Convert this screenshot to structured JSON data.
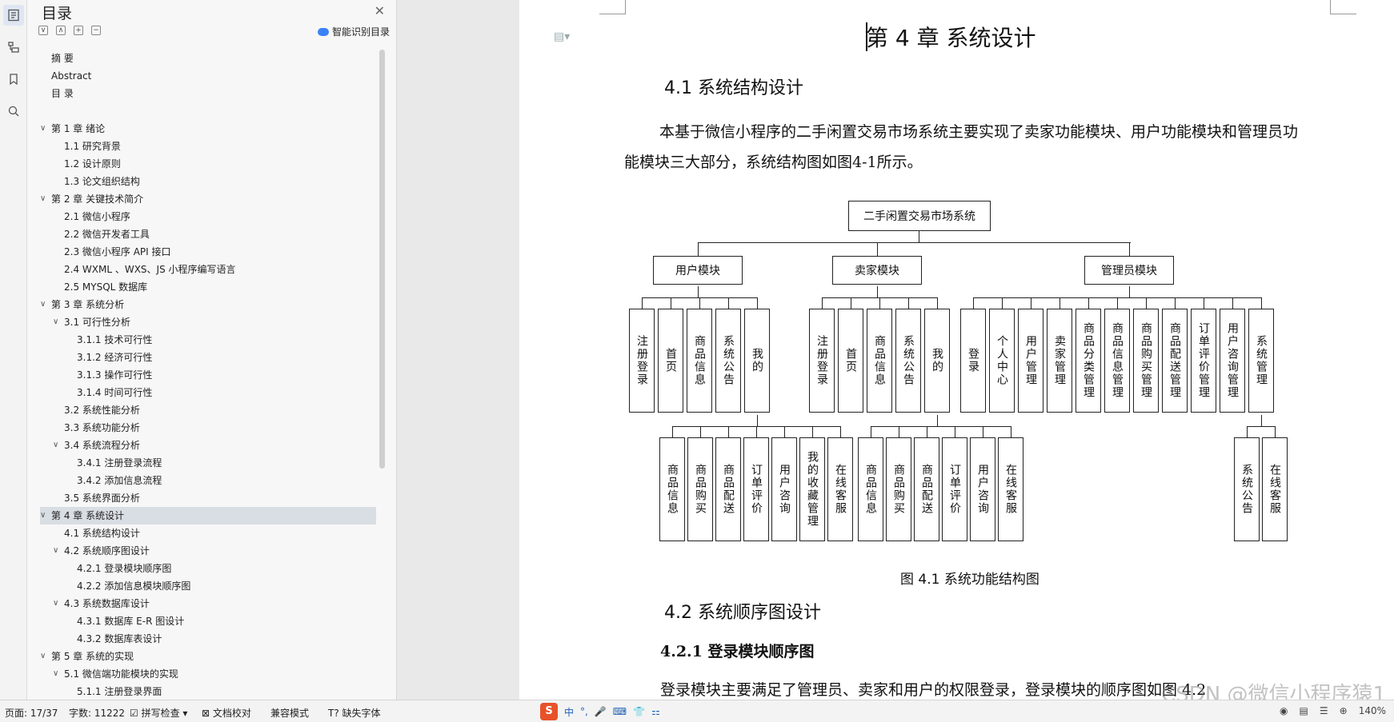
{
  "nav": {
    "title": "目录",
    "smart_toc": "智能识别目录",
    "items": [
      {
        "text": "摘  要",
        "level": 0
      },
      {
        "text": "Abstract",
        "level": 0
      },
      {
        "text": "目    录",
        "level": 0
      },
      {
        "text": "",
        "level": 0
      },
      {
        "text": "第 1 章    绪论",
        "level": 0,
        "caret": "∨"
      },
      {
        "text": "1.1 研究背景",
        "level": 1
      },
      {
        "text": "1.2 设计原则",
        "level": 1
      },
      {
        "text": "1.3 论文组织结构",
        "level": 1
      },
      {
        "text": "第 2 章    关键技术简介",
        "level": 0,
        "caret": "∨"
      },
      {
        "text": "2.1  微信小程序",
        "level": 1
      },
      {
        "text": "2.2  微信开发者工具",
        "level": 1
      },
      {
        "text": "2.3 微信小程序 API 接口",
        "level": 1
      },
      {
        "text": "2.4 WXML 、WXS、JS 小程序编写语言",
        "level": 1
      },
      {
        "text": "2.5 MYSQL 数据库",
        "level": 1
      },
      {
        "text": "第 3 章    系统分析",
        "level": 0,
        "caret": "∨"
      },
      {
        "text": "3.1  可行性分析",
        "level": 1,
        "caret": "∨"
      },
      {
        "text": "3.1.1 技术可行性",
        "level": 2
      },
      {
        "text": "3.1.2  经济可行性",
        "level": 2
      },
      {
        "text": "3.1.3  操作可行性",
        "level": 2
      },
      {
        "text": "3.1.4 时间可行性",
        "level": 2
      },
      {
        "text": "3.2  系统性能分析",
        "level": 1
      },
      {
        "text": "3.3  系统功能分析",
        "level": 1
      },
      {
        "text": "3.4  系统流程分析",
        "level": 1,
        "caret": "∨"
      },
      {
        "text": "3.4.1 注册登录流程",
        "level": 2
      },
      {
        "text": "3.4.2 添加信息流程",
        "level": 2
      },
      {
        "text": "3.5 系统界面分析",
        "level": 1
      },
      {
        "text": "第 4 章    系统设计",
        "level": 0,
        "caret": "∨",
        "selected": true
      },
      {
        "text": "4.1 系统结构设计",
        "level": 1
      },
      {
        "text": "4.2 系统顺序图设计",
        "level": 1,
        "caret": "∨"
      },
      {
        "text": "4.2.1 登录模块顺序图",
        "level": 2
      },
      {
        "text": "4.2.2 添加信息模块顺序图",
        "level": 2
      },
      {
        "text": "4.3 系统数据库设计",
        "level": 1,
        "caret": "∨"
      },
      {
        "text": "4.3.1  数据库 E-R 图设计",
        "level": 2
      },
      {
        "text": "4.3.2  数据库表设计",
        "level": 2
      },
      {
        "text": "第 5 章  系统的实现",
        "level": 0,
        "caret": "∨"
      },
      {
        "text": "5.1 微信端功能模块的实现",
        "level": 1,
        "caret": "∨"
      },
      {
        "text": "5.1.1 注册登录界面",
        "level": 2
      }
    ]
  },
  "doc": {
    "chapter_title": "第 4 章    系统设计",
    "h41": "4.1 系统结构设计",
    "para1": "本基于微信小程序的二手闲置交易市场系统主要实现了卖家功能模块、用户功能模块和管理员功能模块三大部分，系统结构图如图4-1所示。",
    "figure_caption": "图 4.1 系统功能结构图",
    "h42": "4.2 系统顺序图设计",
    "h421": "4.2.1 登录模块顺序图",
    "para2": "登录模块主要满足了管理员、卖家和用户的权限登录，登录模块的顺序图如图  4.2"
  },
  "diagram": {
    "root": "二手闲置交易市场系统",
    "modules": [
      "用户模块",
      "卖家模块",
      "管理员模块"
    ],
    "user_children": [
      "注册登录",
      "首页",
      "商品信息",
      "系统公告",
      "我的"
    ],
    "user_mine": [
      "商品信息",
      "商品购买",
      "商品配送",
      "订单评价",
      "用户咨询",
      "我的收藏管理",
      "在线客服"
    ],
    "seller_children": [
      "注册登录",
      "首页",
      "商品信息",
      "系统公告",
      "我的"
    ],
    "seller_mine": [
      "商品信息",
      "商品购买",
      "商品配送",
      "订单评价",
      "用户咨询",
      "在线客服"
    ],
    "admin_children": [
      "登录",
      "个人中心",
      "用户管理",
      "卖家管理",
      "商品分类管理",
      "商品信息管理",
      "商品购买管理",
      "商品配送管理",
      "订单评价管理",
      "用户咨询管理",
      "系统管理"
    ],
    "admin_sys": [
      "系统公告",
      "在线客服"
    ]
  },
  "status": {
    "page": "页面: 17/37",
    "words": "字数: 11222",
    "spell": "拼写检查",
    "proof": "文档校对",
    "compat": "兼容模式",
    "font_missing": "缺失字体",
    "ime": [
      "中",
      "°,",
      "🎤",
      "⌨",
      "👕",
      "⚏"
    ],
    "zoom": "140%"
  },
  "watermark": "CSDN @微信小程序猿1"
}
